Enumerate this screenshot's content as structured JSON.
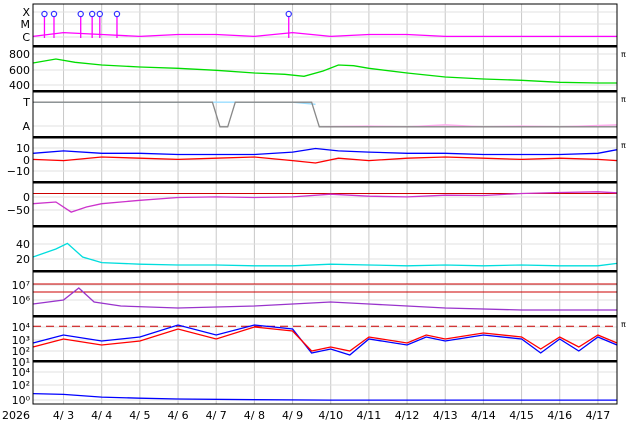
{
  "chart_data": {
    "type": "line",
    "year_label": "2026",
    "x_ticks": [
      "4/ 3",
      "4/ 4",
      "4/ 5",
      "4/ 6",
      "4/ 7",
      "4/ 8",
      "4/ 9",
      "4/10",
      "4/11",
      "4/12",
      "4/13",
      "4/14",
      "4/15",
      "4/16",
      "4/17"
    ],
    "x_range_days": [
      2.2,
      17.5
    ],
    "right_marker": "π",
    "panels": [
      {
        "id": "xray-class",
        "tick_labels": [
          "X",
          "M",
          "C"
        ],
        "series": [
          {
            "color": "#ff00ff",
            "points": [
              [
                2.2,
                0.2
              ],
              [
                3.0,
                0.3
              ],
              [
                4.0,
                0.25
              ],
              [
                5.0,
                0.2
              ],
              [
                6.0,
                0.25
              ],
              [
                7.0,
                0.25
              ],
              [
                8.0,
                0.2
              ],
              [
                9.0,
                0.3
              ],
              [
                10.0,
                0.2
              ],
              [
                11.0,
                0.25
              ],
              [
                12.0,
                0.25
              ],
              [
                13.0,
                0.2
              ],
              [
                14.0,
                0.2
              ],
              [
                15.0,
                0.2
              ],
              [
                16.0,
                0.2
              ],
              [
                17.5,
                0.2
              ]
            ]
          }
        ],
        "markers": [
          2.5,
          2.75,
          3.45,
          3.75,
          3.95,
          4.4,
          8.9
        ]
      },
      {
        "id": "solar-wind-speed",
        "tick_labels": [
          "800",
          "600",
          "400"
        ],
        "ylim": [
          250,
          850
        ],
        "series": [
          {
            "color": "#00dd00",
            "points": [
              [
                2.2,
                640
              ],
              [
                2.8,
                700
              ],
              [
                3.3,
                650
              ],
              [
                4.0,
                610
              ],
              [
                5.0,
                580
              ],
              [
                6.0,
                560
              ],
              [
                7.0,
                530
              ],
              [
                8.0,
                490
              ],
              [
                8.8,
                470
              ],
              [
                9.3,
                440
              ],
              [
                9.8,
                520
              ],
              [
                10.2,
                610
              ],
              [
                10.6,
                600
              ],
              [
                11.0,
                560
              ],
              [
                12.0,
                490
              ],
              [
                13.0,
                430
              ],
              [
                14.0,
                400
              ],
              [
                15.0,
                380
              ],
              [
                16.0,
                350
              ],
              [
                17.0,
                340
              ],
              [
                17.5,
                340
              ]
            ]
          }
        ]
      },
      {
        "id": "imf-direction",
        "tick_labels": [
          "T",
          "A"
        ],
        "series": [
          {
            "color": "#99ddff",
            "points": [
              [
                2.2,
                0.8
              ],
              [
                4.0,
                0.8
              ],
              [
                6.0,
                0.8
              ],
              [
                7.2,
                0.8
              ],
              [
                7.5,
                0.8
              ],
              [
                9.0,
                0.8
              ],
              [
                9.6,
                0.75
              ]
            ]
          },
          {
            "color": "#ffaaee",
            "points": [
              [
                9.8,
                0.2
              ],
              [
                11.0,
                0.22
              ],
              [
                12.0,
                0.2
              ],
              [
                13.0,
                0.25
              ],
              [
                14.0,
                0.2
              ],
              [
                15.0,
                0.22
              ],
              [
                16.0,
                0.2
              ],
              [
                17.5,
                0.25
              ]
            ]
          },
          {
            "color": "#888888",
            "points": [
              [
                2.2,
                0.8
              ],
              [
                6.9,
                0.8
              ],
              [
                7.1,
                0.2
              ],
              [
                7.3,
                0.2
              ],
              [
                7.5,
                0.8
              ],
              [
                9.5,
                0.8
              ],
              [
                9.7,
                0.2
              ],
              [
                17.5,
                0.2
              ]
            ]
          }
        ]
      },
      {
        "id": "imf-bt-bz",
        "tick_labels": [
          "10",
          "0",
          "−10"
        ],
        "ylim": [
          -18,
          15
        ],
        "series": [
          {
            "color": "#0000ff",
            "points": [
              [
                2.2,
                4
              ],
              [
                3.0,
                6
              ],
              [
                4.0,
                4
              ],
              [
                5.0,
                4
              ],
              [
                6.0,
                3
              ],
              [
                7.0,
                3
              ],
              [
                8.0,
                3
              ],
              [
                9.0,
                5
              ],
              [
                9.6,
                8
              ],
              [
                10.2,
                6
              ],
              [
                11.0,
                5
              ],
              [
                12.0,
                4
              ],
              [
                13.0,
                4
              ],
              [
                14.0,
                3
              ],
              [
                15.0,
                3
              ],
              [
                16.0,
                3
              ],
              [
                17.0,
                4
              ],
              [
                17.5,
                7
              ]
            ]
          },
          {
            "color": "#ff0000",
            "points": [
              [
                2.2,
                -1
              ],
              [
                3.0,
                -2
              ],
              [
                4.0,
                1
              ],
              [
                5.0,
                0
              ],
              [
                6.0,
                -1
              ],
              [
                7.0,
                0
              ],
              [
                8.0,
                1
              ],
              [
                9.0,
                -2
              ],
              [
                9.6,
                -4
              ],
              [
                10.2,
                0
              ],
              [
                11.0,
                -2
              ],
              [
                12.0,
                0
              ],
              [
                13.0,
                1
              ],
              [
                14.0,
                0
              ],
              [
                15.0,
                -1
              ],
              [
                16.0,
                0
              ],
              [
                17.0,
                -1
              ],
              [
                17.5,
                -2
              ]
            ]
          }
        ]
      },
      {
        "id": "dst",
        "tick_labels": [
          "0",
          "−50"
        ],
        "ylim": [
          -90,
          25
        ],
        "series": [
          {
            "color": "#cc33cc",
            "points": [
              [
                2.2,
                -30
              ],
              [
                2.8,
                -25
              ],
              [
                3.2,
                -55
              ],
              [
                3.6,
                -40
              ],
              [
                4.0,
                -30
              ],
              [
                5.0,
                -20
              ],
              [
                6.0,
                -12
              ],
              [
                7.0,
                -10
              ],
              [
                8.0,
                -12
              ],
              [
                9.0,
                -10
              ],
              [
                10.0,
                -2
              ],
              [
                11.0,
                -8
              ],
              [
                12.0,
                -10
              ],
              [
                13.0,
                -5
              ],
              [
                14.0,
                -6
              ],
              [
                15.0,
                0
              ],
              [
                16.0,
                3
              ],
              [
                17.0,
                5
              ],
              [
                17.5,
                2
              ]
            ]
          }
        ],
        "ref_lines": [
          {
            "y": 0,
            "color": "#cc0000"
          }
        ]
      },
      {
        "id": "density",
        "tick_labels": [
          "40",
          "20"
        ],
        "ylim": [
          0,
          50
        ],
        "series": [
          {
            "color": "#00dddd",
            "points": [
              [
                2.2,
                15
              ],
              [
                2.8,
                25
              ],
              [
                3.1,
                32
              ],
              [
                3.5,
                15
              ],
              [
                4.0,
                8
              ],
              [
                5.0,
                6
              ],
              [
                6.0,
                5
              ],
              [
                7.0,
                5
              ],
              [
                8.0,
                4
              ],
              [
                9.0,
                4
              ],
              [
                10.0,
                6
              ],
              [
                11.0,
                5
              ],
              [
                12.0,
                4
              ],
              [
                13.0,
                5
              ],
              [
                14.0,
                4
              ],
              [
                15.0,
                5
              ],
              [
                16.0,
                4
              ],
              [
                17.0,
                4
              ],
              [
                17.5,
                7
              ]
            ]
          }
        ]
      },
      {
        "id": "proton-flux",
        "tick_labels": [
          "10⁷",
          "10⁶"
        ],
        "series": [
          {
            "color": "#9933cc",
            "points": [
              [
                2.2,
                0.25
              ],
              [
                3.0,
                0.35
              ],
              [
                3.4,
                0.65
              ],
              [
                3.8,
                0.3
              ],
              [
                4.5,
                0.2
              ],
              [
                6.0,
                0.15
              ],
              [
                8.0,
                0.2
              ],
              [
                9.0,
                0.25
              ],
              [
                10.0,
                0.3
              ],
              [
                11.0,
                0.25
              ],
              [
                12.0,
                0.2
              ],
              [
                13.0,
                0.15
              ],
              [
                15.0,
                0.1
              ],
              [
                17.5,
                0.1
              ]
            ]
          }
        ],
        "ref_lines": [
          {
            "y": 0.75,
            "color": "#cc0000"
          },
          {
            "y": 0.55,
            "color": "#cc0000"
          }
        ]
      },
      {
        "id": "electron-flux",
        "tick_labels": [
          "10⁴",
          "10³",
          "10²",
          "10¹"
        ],
        "series": [
          {
            "color": "#0000ff",
            "points": [
              [
                2.2,
                0.4
              ],
              [
                3.0,
                0.6
              ],
              [
                4.0,
                0.45
              ],
              [
                5.0,
                0.55
              ],
              [
                6.0,
                0.85
              ],
              [
                7.0,
                0.6
              ],
              [
                8.0,
                0.85
              ],
              [
                9.0,
                0.75
              ],
              [
                9.5,
                0.15
              ],
              [
                10.0,
                0.25
              ],
              [
                10.5,
                0.1
              ],
              [
                11.0,
                0.5
              ],
              [
                12.0,
                0.35
              ],
              [
                12.5,
                0.55
              ],
              [
                13.0,
                0.45
              ],
              [
                14.0,
                0.6
              ],
              [
                15.0,
                0.5
              ],
              [
                15.5,
                0.15
              ],
              [
                16.0,
                0.5
              ],
              [
                16.5,
                0.2
              ],
              [
                17.0,
                0.55
              ],
              [
                17.5,
                0.35
              ]
            ]
          },
          {
            "color": "#ff0000",
            "points": [
              [
                2.2,
                0.3
              ],
              [
                3.0,
                0.5
              ],
              [
                4.0,
                0.35
              ],
              [
                5.0,
                0.45
              ],
              [
                6.0,
                0.75
              ],
              [
                7.0,
                0.5
              ],
              [
                8.0,
                0.8
              ],
              [
                9.0,
                0.7
              ],
              [
                9.5,
                0.2
              ],
              [
                10.0,
                0.3
              ],
              [
                10.5,
                0.2
              ],
              [
                11.0,
                0.55
              ],
              [
                12.0,
                0.4
              ],
              [
                12.5,
                0.6
              ],
              [
                13.0,
                0.5
              ],
              [
                14.0,
                0.65
              ],
              [
                15.0,
                0.55
              ],
              [
                15.5,
                0.25
              ],
              [
                16.0,
                0.55
              ],
              [
                16.5,
                0.3
              ],
              [
                17.0,
                0.6
              ],
              [
                17.5,
                0.4
              ]
            ]
          }
        ],
        "ref_lines": [
          {
            "y": 0.82,
            "color": "#cc0000",
            "dashed": true
          }
        ]
      },
      {
        "id": "electron-fluence",
        "tick_labels": [
          "10⁴",
          "10²",
          "10⁰"
        ],
        "series": [
          {
            "color": "#0000ff",
            "points": [
              [
                2.2,
                0.22
              ],
              [
                3.0,
                0.2
              ],
              [
                4.0,
                0.13
              ],
              [
                5.0,
                0.1
              ],
              [
                6.0,
                0.08
              ],
              [
                8.0,
                0.06
              ],
              [
                10.0,
                0.05
              ],
              [
                12.0,
                0.05
              ],
              [
                14.0,
                0.05
              ],
              [
                16.0,
                0.05
              ],
              [
                17.5,
                0.05
              ]
            ]
          }
        ]
      }
    ]
  }
}
